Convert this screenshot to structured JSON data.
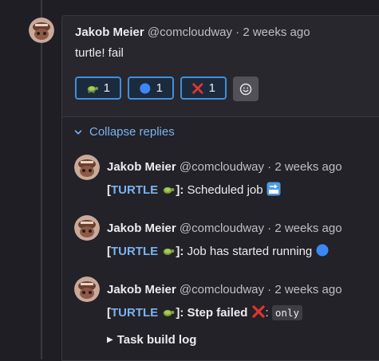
{
  "main_note": {
    "author": "Jakob Meier",
    "handle": "@comcloudway",
    "separator": "·",
    "time": "2 weeks ago",
    "body": "turtle! fail",
    "reactions": [
      {
        "emoji": "turtle-emoji",
        "count": "1"
      },
      {
        "emoji": "blue-circle-emoji",
        "count": "1"
      },
      {
        "emoji": "cross-mark-emoji",
        "count": "1"
      }
    ],
    "add_reaction_icon": "smiley-icon"
  },
  "replies_toggle": {
    "label": "Collapse replies",
    "icon": "chevron-down-icon"
  },
  "replies": [
    {
      "author": "Jakob Meier",
      "handle": "@comcloudway",
      "separator": "·",
      "time": "2 weeks ago",
      "bracket_open": "[",
      "tag": "TURTLE",
      "bracket_close": "]",
      "colon": ":",
      "text": " Scheduled job",
      "trailing_emoji": "soon-arrow-emoji"
    },
    {
      "author": "Jakob Meier",
      "handle": "@comcloudway",
      "separator": "·",
      "time": "2 weeks ago",
      "bracket_open": "[",
      "tag": "TURTLE",
      "bracket_close": "]",
      "colon": ":",
      "text": " Job has started running",
      "trailing_emoji": "blue-circle-emoji"
    },
    {
      "author": "Jakob Meier",
      "handle": "@comcloudway",
      "separator": "·",
      "time": "2 weeks ago",
      "bracket_open": "[",
      "tag": "TURTLE",
      "bracket_close": "]",
      "colon": ":",
      "text": " Step failed",
      "trailing_emoji": "cross-mark-emoji",
      "code": "only",
      "details_label": "Task build log"
    }
  ],
  "colors": {
    "accent": "#428fdc",
    "link": "#7ab3f0",
    "background": "#1f1e24",
    "card": "#28272d"
  }
}
